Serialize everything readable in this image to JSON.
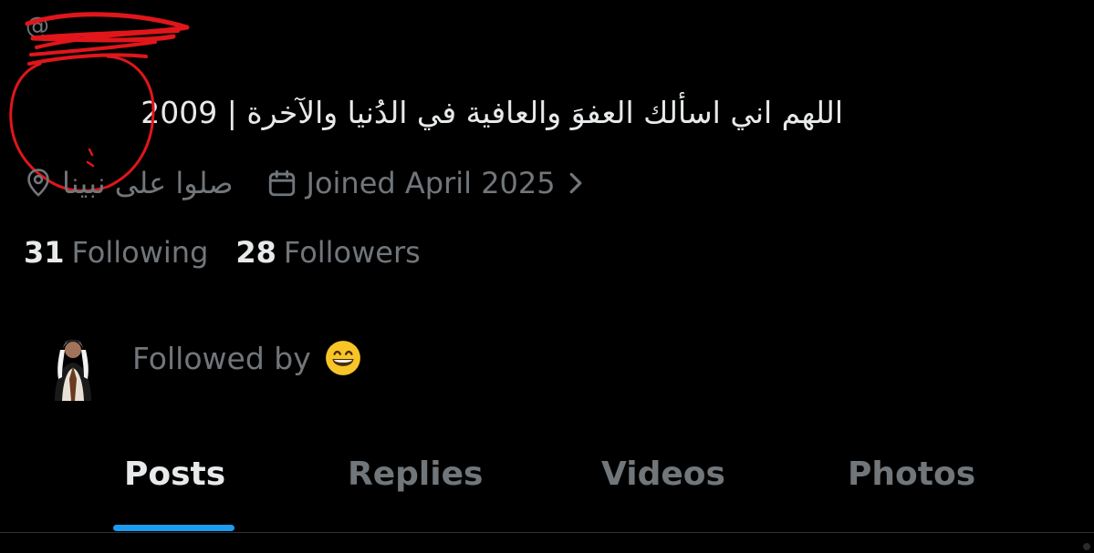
{
  "profile": {
    "handle": "@",
    "bio": "اللهم اني اسألك العفوَ والعافية في الدُنيا والآخرة | 2009",
    "location": "صلوا على نبينا",
    "joined": "Joined April 2025"
  },
  "stats": {
    "following_count": "31",
    "following_label": "Following",
    "followers_count": "28",
    "followers_label": "Followers"
  },
  "followed_by": {
    "label": "Followed by"
  },
  "tabs": [
    {
      "label": "Posts",
      "active": true
    },
    {
      "label": "Replies",
      "active": false
    },
    {
      "label": "Videos",
      "active": false
    },
    {
      "label": "Photos",
      "active": false
    }
  ],
  "colors": {
    "background": "#000000",
    "primary_text": "#e7e9ea",
    "secondary_text": "#71767b",
    "accent": "#1d9bf0",
    "annotation_red": "#e0161b"
  },
  "icons": [
    "location-icon",
    "calendar-icon",
    "chevron-right-icon",
    "grinning-emoji-icon"
  ]
}
